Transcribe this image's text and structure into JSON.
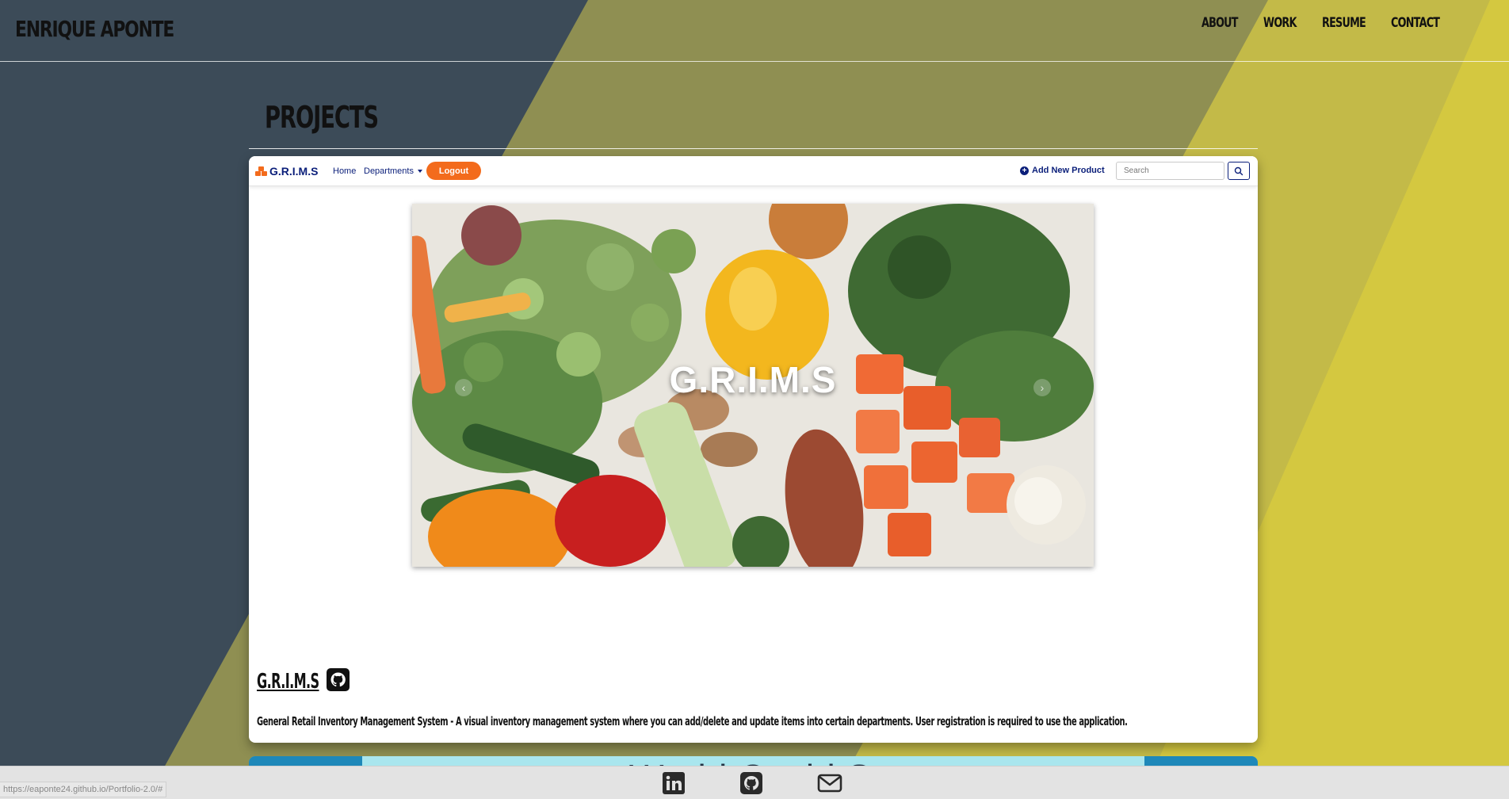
{
  "header": {
    "brand": "ENRIQUE APONTE",
    "nav": [
      "ABOUT",
      "WORK",
      "RESUME",
      "CONTACT"
    ]
  },
  "section": {
    "title": "PROJECTS"
  },
  "project": {
    "name": "G.R.I.M.S",
    "description": "General Retail Inventory Management System - A visual inventory management system where you can add/delete and update items into certain departments. User registration is required to use the application.",
    "github_icon": "github-icon",
    "screenshot": {
      "logo": "G.R.I.M.S",
      "nav_home": "Home",
      "nav_departments": "Departments",
      "logout": "Logout",
      "add_product": "Add New Product",
      "search_placeholder": "Search",
      "hero_title": "G.R.I.M.S"
    }
  },
  "next_project": {
    "title_partial": "World Covid Stat"
  },
  "footer": {
    "icons": [
      "linkedin-icon",
      "github-icon",
      "mail-icon"
    ]
  },
  "status_bar": {
    "url": "https://eaponte24.github.io/Portfolio-2.0/#"
  },
  "colors": {
    "bg_dark": "#3c4b58",
    "bg_olive": "#8f8f52",
    "bg_yellow": "#d4c840",
    "accent_orange": "#f36b1c",
    "navy": "#0b1f7a"
  }
}
